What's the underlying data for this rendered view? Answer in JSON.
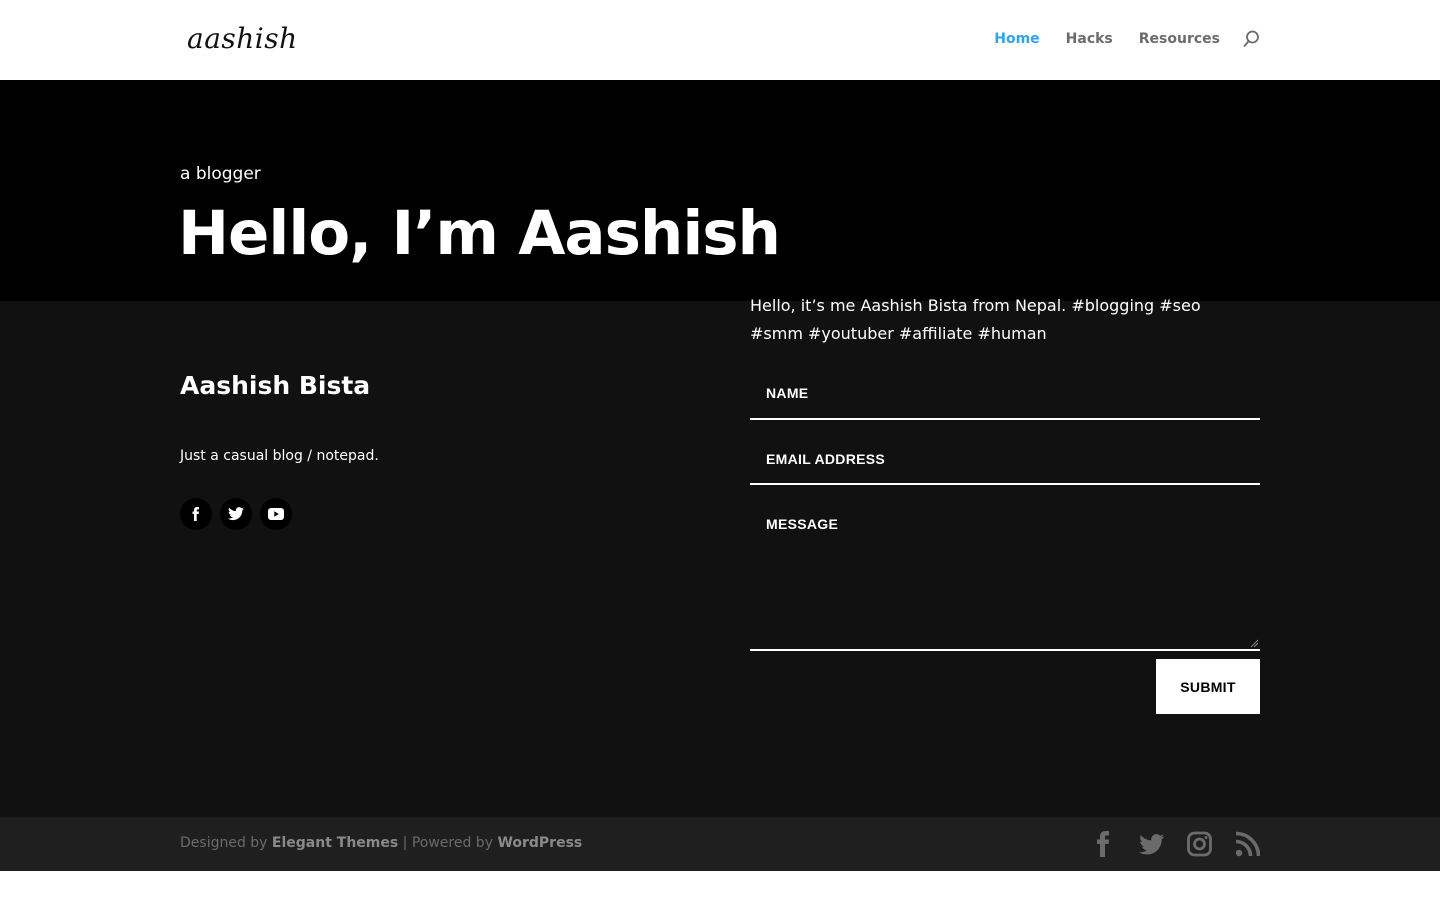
{
  "header": {
    "logo": "aashish",
    "nav": [
      {
        "label": "Home",
        "active": true
      },
      {
        "label": "Hacks",
        "active": false
      },
      {
        "label": "Resources",
        "active": false
      }
    ],
    "search_icon": "search-icon"
  },
  "hero": {
    "kicker": "a blogger",
    "title": "Hello, I’m Aashish"
  },
  "about": {
    "name": "Aashish Bista",
    "tagline": "Just a casual blog / notepad.",
    "social_icons": [
      "facebook-icon",
      "twitter-icon",
      "youtube-icon"
    ]
  },
  "contact": {
    "intro": "Hello, it’s me Aashish Bista from Nepal. #blogging #seo #smm #youtuber #affiliate #human",
    "name_placeholder": "NAME",
    "email_placeholder": "EMAIL ADDRESS",
    "message_placeholder": "MESSAGE",
    "submit_label": "SUBMIT"
  },
  "footer": {
    "designed_by": "Designed by",
    "elegant_themes": "Elegant Themes",
    "powered_by": "| Powered by",
    "wordpress": "WordPress",
    "icons": [
      "facebook-icon",
      "twitter-icon",
      "instagram-icon",
      "rss-icon"
    ]
  },
  "colors": {
    "accent": "#2ea3f2",
    "hero_bg": "#000000",
    "main_bg": "#111111",
    "footer_bg": "#1f1f1f"
  }
}
